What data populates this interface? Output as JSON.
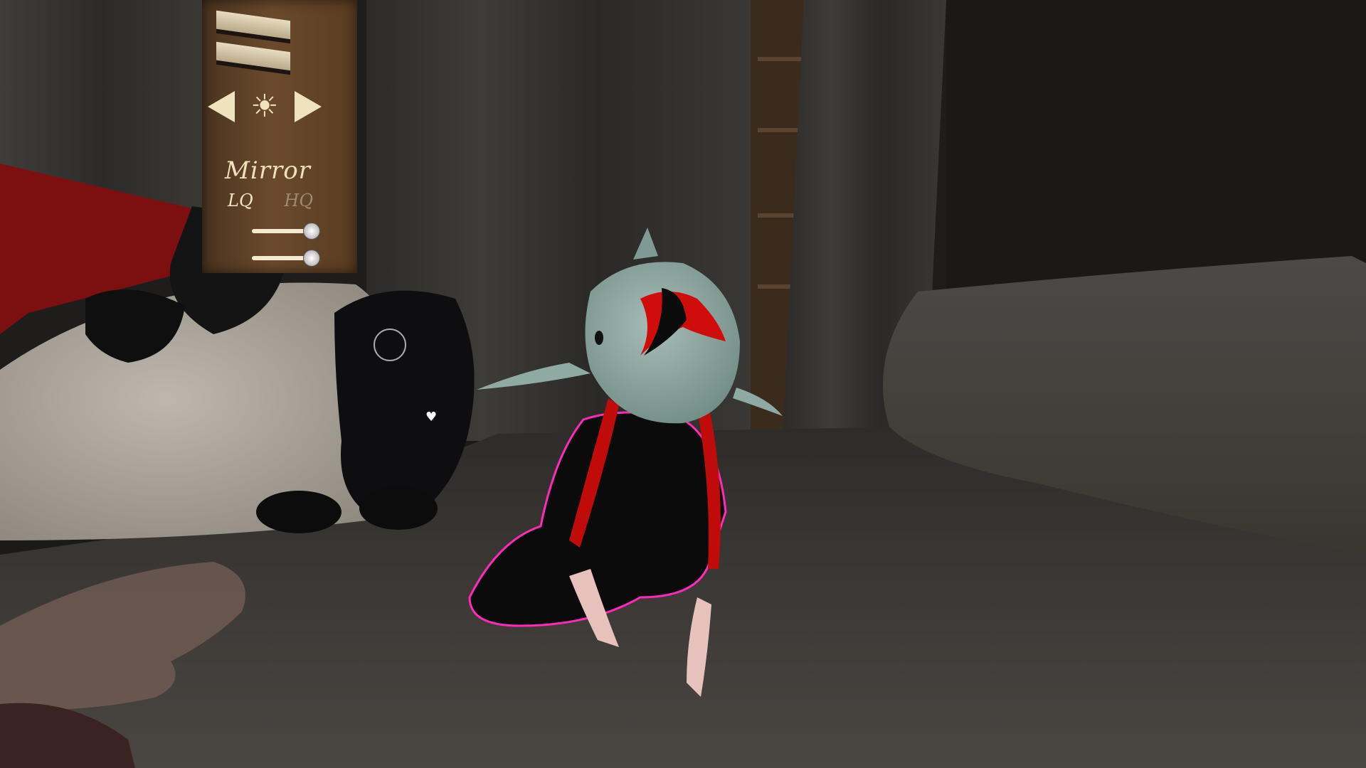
{
  "panel": {
    "mirror_label": "Mirror",
    "lq_label": "LQ",
    "hq_label": "HQ",
    "brightness_icon": "sun-icon",
    "slider_1_level": 0.95,
    "slider_2_level": 0.92
  },
  "colors": {
    "panel_text": "#f0e2b8",
    "hq_inactive": "#9c8b72",
    "shark": "#8fa9a3",
    "outline_pink": "#ff2bb8",
    "hair_red": "#d40a0a"
  }
}
